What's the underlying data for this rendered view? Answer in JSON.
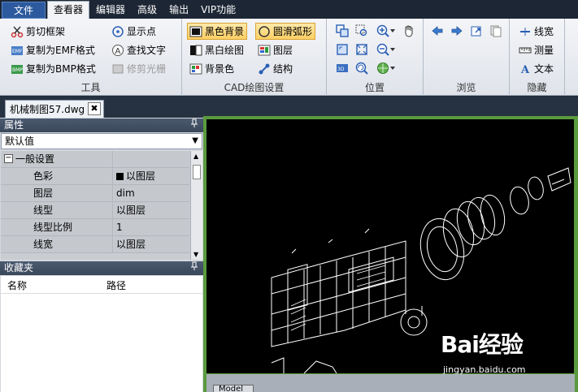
{
  "menu": {
    "tabs": [
      "文件",
      "查看器",
      "编辑器",
      "高级",
      "输出",
      "VIP功能"
    ],
    "active_index": 1
  },
  "ribbon": {
    "tools": {
      "label": "工具",
      "buttons": [
        "剪切框架",
        "复制为EMF格式",
        "复制为BMP格式",
        "显示点",
        "查找文字",
        "修剪光栅"
      ]
    },
    "cad_settings": {
      "label": "CAD绘图设置",
      "buttons": [
        "黑色背景",
        "黑白绘图",
        "背景色",
        "圆滑弧形",
        "图层",
        "结构"
      ]
    },
    "position": {
      "label": "位置"
    },
    "browse": {
      "label": "浏览"
    },
    "hide": {
      "label": "隐藏",
      "buttons": [
        "线宽",
        "测量",
        "文本"
      ]
    }
  },
  "document": {
    "tab_title": "机械制图57.dwg",
    "close_glyph": "✖"
  },
  "properties": {
    "title": "属性",
    "pin_glyph": "📌",
    "dropdown_value": "默认值",
    "category": "一般设置",
    "rows": [
      {
        "name": "色彩",
        "value": "以图层",
        "swatch": "#000000"
      },
      {
        "name": "图层",
        "value": "dim"
      },
      {
        "name": "线型",
        "value": "以图层"
      },
      {
        "name": "线型比例",
        "value": "1"
      },
      {
        "name": "线宽",
        "value": "以图层"
      }
    ]
  },
  "favorites": {
    "title": "收藏夹",
    "columns": [
      "名称",
      "路径"
    ]
  },
  "canvas": {
    "frame_color": "#5a9a3e",
    "model_tab": "Model"
  },
  "watermark": {
    "brand": "Bai经验",
    "url": "jingyan.baidu.com"
  }
}
